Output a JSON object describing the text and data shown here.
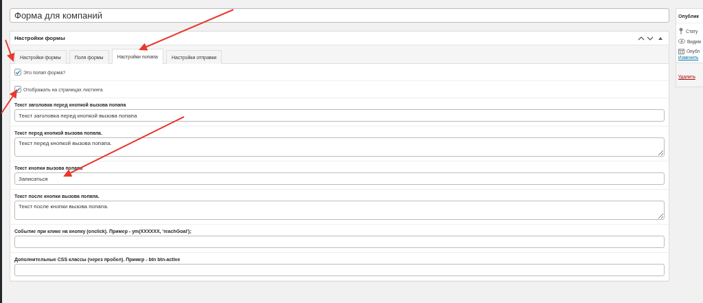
{
  "title_field": {
    "value": "Форма для компаний"
  },
  "metabox": {
    "title": "Настройки формы",
    "tabs": [
      {
        "label": "Настройки формы",
        "selected": false
      },
      {
        "label": "Поля формы",
        "selected": false
      },
      {
        "label": "Настройки попапа",
        "selected": true
      },
      {
        "label": "Настройки отправки",
        "selected": false
      }
    ],
    "fields": [
      {
        "kind": "checkbox",
        "label": "Это попап форма?",
        "checked": true
      },
      {
        "kind": "checkbox",
        "label": "Отображать на страницах листинга",
        "checked": true
      },
      {
        "kind": "input",
        "label": "Текст заголовка перед кнопкой вызова попапа",
        "value": "Текст заголовка перед кнопкой вызова попапа"
      },
      {
        "kind": "textarea",
        "label": "Текст перед кнопкой вызова попапа.",
        "value": "Текст перед кнопкой вызова попапа."
      },
      {
        "kind": "input",
        "label": "Текст кнопки вызова попапа",
        "value": "Записаться"
      },
      {
        "kind": "textarea",
        "label": "Текст после кнопки вызова попапа.",
        "value": "Текст после кнопки вызова попапа."
      },
      {
        "kind": "input",
        "label": "Событие при клике на кнопку (onclick). Пример - ym(XXXXXX, 'reachGoal');"
      },
      {
        "kind": "input",
        "label": "Дополнительные CSS классы (через пробел). Пример - btn btn-active"
      }
    ]
  },
  "publish_box": {
    "title": "Опублик",
    "rows": [
      {
        "kind": "status",
        "label": "Стату"
      },
      {
        "kind": "visibility",
        "label": "Видим"
      },
      {
        "kind": "date",
        "label": "Опубл"
      }
    ],
    "edit_link": "Изменить",
    "delete_link": "Удалить"
  }
}
